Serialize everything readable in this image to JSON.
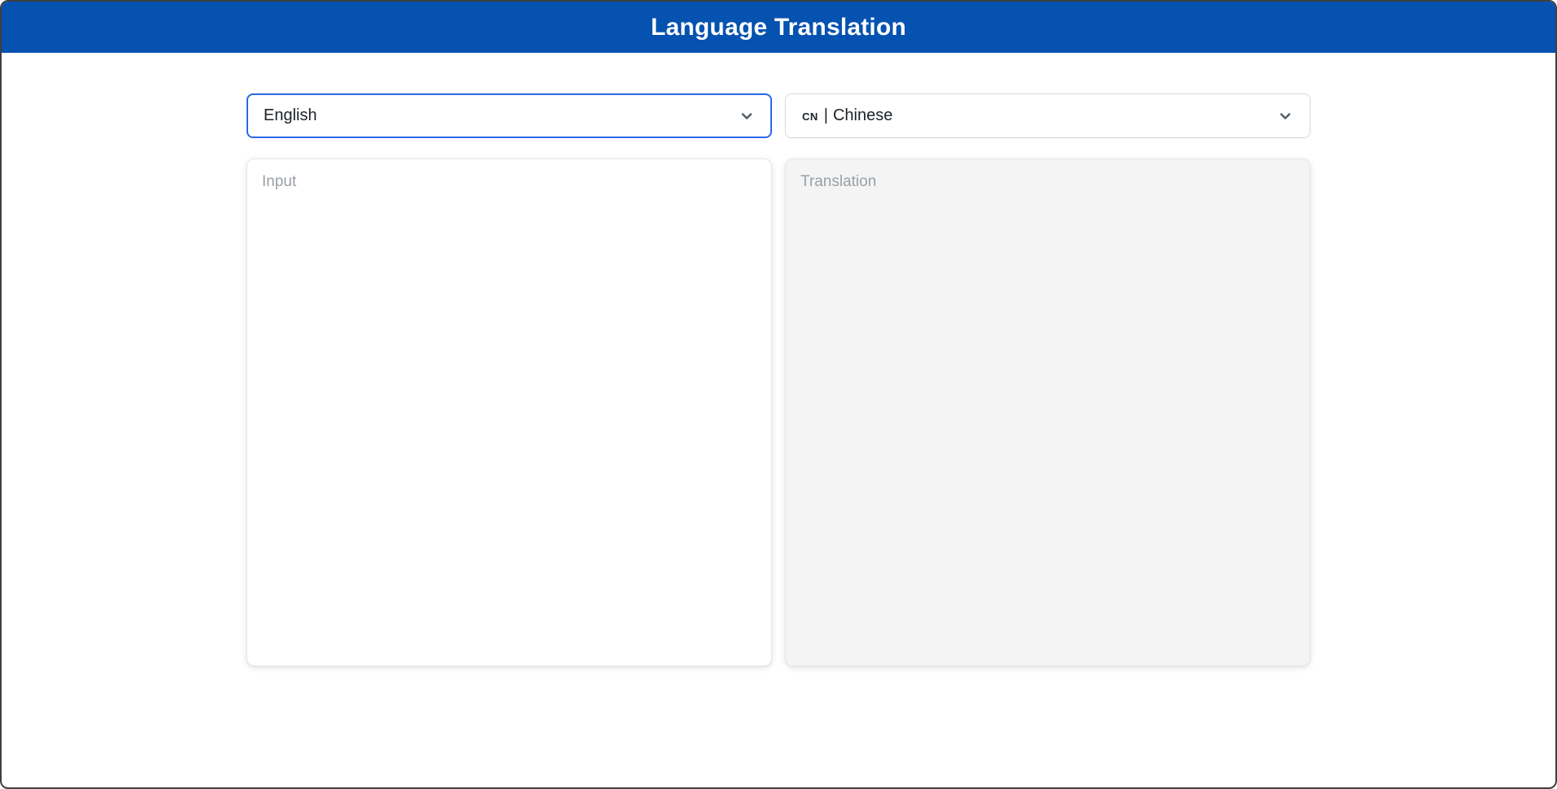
{
  "window": {
    "frame_color": "#3f3f3f",
    "background": "#ffffff"
  },
  "header": {
    "title": "Language Translation",
    "background": "#0552b0",
    "text_color": "#ffffff"
  },
  "source_language": {
    "selected": "English",
    "focus_border_color": "#2969e6"
  },
  "target_language": {
    "flag_text": "CN",
    "separator": "|",
    "name": "Chinese",
    "border_color": "#d9d9d9"
  },
  "input_panel": {
    "placeholder": "Input",
    "value": "",
    "background": "#ffffff"
  },
  "translation_panel": {
    "placeholder": "Translation",
    "value": "",
    "background": "#f4f4f4"
  },
  "icons": {
    "chevron_down": "chevron-down-icon",
    "chevron_color": "#545b62"
  }
}
